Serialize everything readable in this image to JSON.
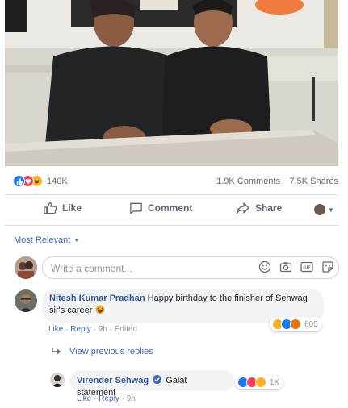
{
  "post": {
    "reactions": {
      "types": [
        "like-icon",
        "love-icon",
        "haha-icon"
      ],
      "count": "140K"
    },
    "comments_count": "1.9K Comments",
    "shares_count": "7.5K Shares",
    "actions": {
      "like": "Like",
      "comment": "Comment",
      "share": "Share"
    }
  },
  "comments_section": {
    "sort_label": "Most Relevant",
    "input_placeholder": "Write a comment...",
    "input_icons": [
      "smiley-icon",
      "camera-icon",
      "gif-icon",
      "sticker-icon"
    ],
    "comments": [
      {
        "author": "Nitesh Kumar Pradhan",
        "text": "Happy birthday to the finisher of Sehwag sir's career",
        "emoji": "laughing-emoji",
        "meta": {
          "like": "Like",
          "reply": "Reply",
          "time": "9h",
          "edited": "Edited"
        },
        "reaction_count": "605",
        "view_previous": "View previous replies"
      }
    ],
    "reply": {
      "author": "Virender Sehwag",
      "verified": true,
      "text": "Galat statement",
      "meta": {
        "like": "Like",
        "reply": "Reply",
        "time": "9h"
      },
      "reaction_count": "1K"
    }
  },
  "colors": {
    "like_blue": "#1877f2",
    "love_red": "#f33e58",
    "haha_yellow": "#f7b125",
    "link": "#365899",
    "accent": "#4267b2"
  }
}
